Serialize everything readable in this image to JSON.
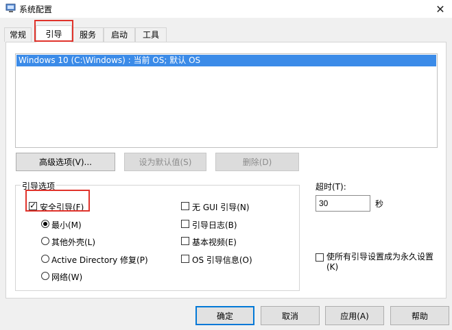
{
  "window": {
    "title": "系统配置",
    "close": "✕"
  },
  "tabs": [
    {
      "label": "常规"
    },
    {
      "label": "引导"
    },
    {
      "label": "服务"
    },
    {
      "label": "启动"
    },
    {
      "label": "工具"
    }
  ],
  "boot_list": {
    "items": [
      "Windows 10 (C:\\Windows) : 当前 OS; 默认 OS"
    ]
  },
  "buttons": {
    "advanced": "高级选项(V)...",
    "set_default": "设为默认值(S)",
    "delete": "删除(D)"
  },
  "boot_options": {
    "group_label": "引导选项",
    "safe_boot": {
      "label": "安全引导(F)",
      "checked": true
    },
    "radios": [
      {
        "label": "最小(M)",
        "checked": true
      },
      {
        "label": "其他外壳(L)",
        "checked": false
      },
      {
        "label": "Active Directory 修复(P)",
        "checked": false
      },
      {
        "label": "网络(W)",
        "checked": false
      }
    ],
    "checkboxes": [
      {
        "label": "无 GUI 引导(N)",
        "checked": false
      },
      {
        "label": "引导日志(B)",
        "checked": false
      },
      {
        "label": "基本视频(E)",
        "checked": false
      },
      {
        "label": "OS 引导信息(O)",
        "checked": false
      }
    ]
  },
  "timeout": {
    "label": "超时(T):",
    "value": "30",
    "unit": "秒"
  },
  "permanent": {
    "label_line1": "使所有引导设置成为永久设置",
    "label_line2": "(K)",
    "checked": false
  },
  "footer": {
    "ok": "确定",
    "cancel": "取消",
    "apply": "应用(A)",
    "help": "帮助"
  },
  "colors": {
    "selection": "#3b8be8",
    "highlight_box": "#e0322a",
    "accent": "#0078d7"
  }
}
